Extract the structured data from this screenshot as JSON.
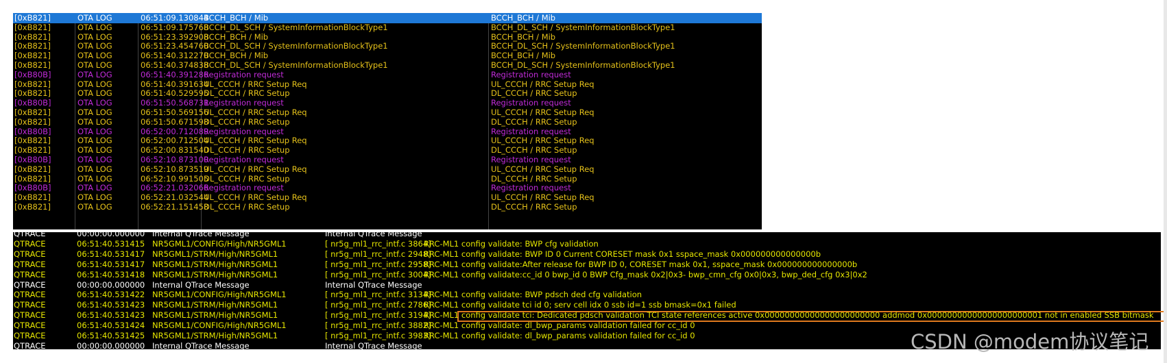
{
  "colors": {
    "ota_default": "#e6c21a",
    "ota_registration": "#c02bd8",
    "ota_selected_bg": "#1e78d6",
    "qtrace_text": "#e6e600",
    "qtrace_header_text": "#ffffff",
    "highlight_border": "#e07a1e"
  },
  "ota_log": [
    {
      "code": "[0xB821]",
      "type": "OTA LOG",
      "time": "06:51:09.130844",
      "summary": "BCCH_BCH / Mib",
      "detail": "BCCH_BCH / Mib",
      "kind": "selected"
    },
    {
      "code": "[0xB821]",
      "type": "OTA LOG",
      "time": "06:51:09.175768",
      "summary": "BCCH_DL_SCH / SystemInformationBlockType1",
      "detail": "BCCH_DL_SCH / SystemInformationBlockType1",
      "kind": "default"
    },
    {
      "code": "[0xB821]",
      "type": "OTA LOG",
      "time": "06:51:23.392908",
      "summary": "BCCH_BCH / Mib",
      "detail": "BCCH_BCH / Mib",
      "kind": "default"
    },
    {
      "code": "[0xB821]",
      "type": "OTA LOG",
      "time": "06:51:23.454760",
      "summary": "BCCH_DL_SCH / SystemInformationBlockType1",
      "detail": "BCCH_DL_SCH / SystemInformationBlockType1",
      "kind": "default"
    },
    {
      "code": "[0xB821]",
      "type": "OTA LOG",
      "time": "06:51:40.312270",
      "summary": "BCCH_BCH / Mib",
      "detail": "BCCH_BCH / Mib",
      "kind": "default"
    },
    {
      "code": "[0xB821]",
      "type": "OTA LOG",
      "time": "06:51:40.374838",
      "summary": "BCCH_DL_SCH / SystemInformationBlockType1",
      "detail": "BCCH_DL_SCH / SystemInformationBlockType1",
      "kind": "default"
    },
    {
      "code": "[0xB80B]",
      "type": "OTA LOG",
      "time": "06:51:40.391286",
      "summary": "Registration request",
      "detail": "Registration request",
      "kind": "registration"
    },
    {
      "code": "[0xB821]",
      "type": "OTA LOG",
      "time": "06:51:40.391634",
      "summary": "UL_CCCH / RRC Setup Req",
      "detail": "UL_CCCH / RRC Setup Req",
      "kind": "default"
    },
    {
      "code": "[0xB821]",
      "type": "OTA LOG",
      "time": "06:51:40.529595",
      "summary": "DL_CCCH / RRC Setup",
      "detail": "DL_CCCH / RRC Setup",
      "kind": "default"
    },
    {
      "code": "[0xB80B]",
      "type": "OTA LOG",
      "time": "06:51:50.568731",
      "summary": "Registration request",
      "detail": "Registration request",
      "kind": "registration"
    },
    {
      "code": "[0xB821]",
      "type": "OTA LOG",
      "time": "06:51:50.569156",
      "summary": "UL_CCCH / RRC Setup Req",
      "detail": "UL_CCCH / RRC Setup Req",
      "kind": "default"
    },
    {
      "code": "[0xB821]",
      "type": "OTA LOG",
      "time": "06:51:50.671598",
      "summary": "DL_CCCH / RRC Setup",
      "detail": "DL_CCCH / RRC Setup",
      "kind": "default"
    },
    {
      "code": "[0xB80B]",
      "type": "OTA LOG",
      "time": "06:52:00.712089",
      "summary": "Registration request",
      "detail": "Registration request",
      "kind": "registration"
    },
    {
      "code": "[0xB821]",
      "type": "OTA LOG",
      "time": "06:52:00.712504",
      "summary": "UL_CCCH / RRC Setup Req",
      "detail": "UL_CCCH / RRC Setup Req",
      "kind": "default"
    },
    {
      "code": "[0xB821]",
      "type": "OTA LOG",
      "time": "06:52:00.831540",
      "summary": "DL_CCCH / RRC Setup",
      "detail": "DL_CCCH / RRC Setup",
      "kind": "default"
    },
    {
      "code": "[0xB80B]",
      "type": "OTA LOG",
      "time": "06:52:10.873100",
      "summary": "Registration request",
      "detail": "Registration request",
      "kind": "registration"
    },
    {
      "code": "[0xB821]",
      "type": "OTA LOG",
      "time": "06:52:10.873519",
      "summary": "UL_CCCH / RRC Setup Req",
      "detail": "UL_CCCH / RRC Setup Req",
      "kind": "default"
    },
    {
      "code": "[0xB821]",
      "type": "OTA LOG",
      "time": "06:52:10.991505",
      "summary": "DL_CCCH / RRC Setup",
      "detail": "DL_CCCH / RRC Setup",
      "kind": "default"
    },
    {
      "code": "[0xB80B]",
      "type": "OTA LOG",
      "time": "06:52:21.032066",
      "summary": "Registration request",
      "detail": "Registration request",
      "kind": "registration"
    },
    {
      "code": "[0xB821]",
      "type": "OTA LOG",
      "time": "06:52:21.032544",
      "summary": "UL_CCCH / RRC Setup Req",
      "detail": "UL_CCCH / RRC Setup Req",
      "kind": "default"
    },
    {
      "code": "[0xB821]",
      "type": "OTA LOG",
      "time": "06:52:21.151458",
      "summary": "DL_CCCH / RRC Setup",
      "detail": "DL_CCCH / RRC Setup",
      "kind": "default"
    }
  ],
  "qtrace_log": [
    {
      "src": "QTRACE",
      "time": "00:00:00.000000",
      "path": "Internal QTrace Message",
      "file": "Internal QTrace Message",
      "msg": "",
      "kind": "header"
    },
    {
      "src": "QTRACE",
      "time": "06:51:40.531415",
      "path": "NR5GML1/CONFIG/High/NR5GML1",
      "file": "[ nr5g_ml1_rrc_intf.c   3864]",
      "msg": "RRC-ML1  config  validate:  BWP  cfg  validation",
      "kind": "trace"
    },
    {
      "src": "QTRACE",
      "time": "06:51:40.531417",
      "path": "NR5GML1/STRM/High/NR5GML1",
      "file": "[ nr5g_ml1_rrc_intf.c   2948]",
      "msg": "RRC-ML1  config  validate:  BWP  ID  0  Current  CORESET  mask  0x1  sspace_mask  0x000000000000000b",
      "kind": "trace"
    },
    {
      "src": "QTRACE",
      "time": "06:51:40.531417",
      "path": "NR5GML1/STRM/High/NR5GML1",
      "file": "[ nr5g_ml1_rrc_intf.c   2958]",
      "msg": "RRC-ML1  config  validate:After  release  for  BWP  ID  0,  CORESET  mask  0x1,  sspace_mask  0x000000000000000b",
      "kind": "trace"
    },
    {
      "src": "QTRACE",
      "time": "06:51:40.531418",
      "path": "NR5GML1/STRM/High/NR5GML1",
      "file": "[ nr5g_ml1_rrc_intf.c   3004]",
      "msg": "RRC-ML1  config  validate:cc_id  0  bwp_id  0  BWP  Cfg_mask  0x2|0x3-  bwp_cmn_cfg  0x0|0x3,  bwp_ded_cfg  0x3|0x2",
      "kind": "trace"
    },
    {
      "src": "QTRACE",
      "time": "00:00:00.000000",
      "path": "Internal QTrace Message",
      "file": "Internal QTrace Message",
      "msg": "",
      "kind": "header"
    },
    {
      "src": "QTRACE",
      "time": "06:51:40.531422",
      "path": "NR5GML1/CONFIG/High/NR5GML1",
      "file": "[ nr5g_ml1_rrc_intf.c   3134]",
      "msg": "RRC-ML1  config  validate:  BWP  pdsch  ded  cfg  validation",
      "kind": "trace"
    },
    {
      "src": "QTRACE",
      "time": "06:51:40.531423",
      "path": "NR5GML1/STRM/High/NR5GML1",
      "file": "[ nr5g_ml1_rrc_intf.c   2786]",
      "msg": "RRC-ML1  config  validate  tci  id  0;  serv  cell  idx  0  ssb  id=1  ssb  bmask=0x1  failed",
      "kind": "trace"
    },
    {
      "src": "QTRACE",
      "time": "06:51:40.531423",
      "path": "NR5GML1/STRM/High/NR5GML1",
      "file": "[ nr5g_ml1_rrc_intf.c   3194]",
      "msg": "RRC-ML1  config  validate  tci:  Dedicated  pdsch  validation  TCI  state  references  active  0x00000000000000000000000  addmod  0x00000000000000000000001  not  in  enabled  SSB  bitmask",
      "kind": "highlight"
    },
    {
      "src": "QTRACE",
      "time": "06:51:40.531424",
      "path": "NR5GML1/CONFIG/High/NR5GML1",
      "file": "[ nr5g_ml1_rrc_intf.c   3882]",
      "msg": "RRC-ML1  config  validate:  dl_bwp_params  validation  failed  for  cc_id  0",
      "kind": "trace"
    },
    {
      "src": "QTRACE",
      "time": "06:51:40.531425",
      "path": "NR5GML1/STRM/High/NR5GML1",
      "file": "[ nr5g_ml1_rrc_intf.c   3983]",
      "msg": "RRC-ML1  config  validate:  dl_bwp_params  validation  failed  for  cc_id  0",
      "kind": "trace"
    },
    {
      "src": "QTRACE",
      "time": "00:00:00.000000",
      "path": "Internal QTrace Message",
      "file": "Internal QTrace Message",
      "msg": "",
      "kind": "header"
    }
  ],
  "watermark": "CSDN @modem协议笔记"
}
